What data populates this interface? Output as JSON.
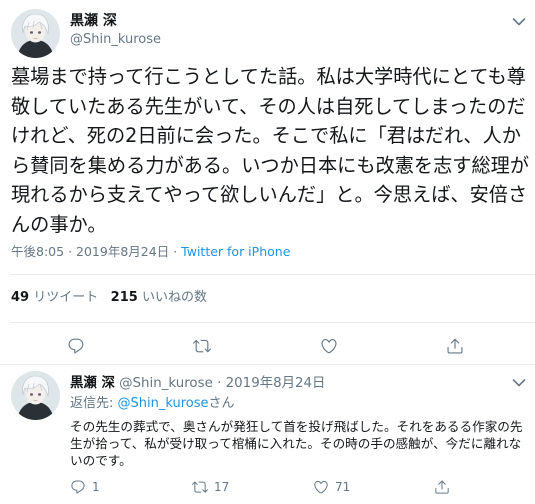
{
  "main_tweet": {
    "display_name": "黒瀬 深",
    "handle": "@Shin_kurose",
    "text": "墓場まで持って行こうとしてた話。私は大学時代にとても尊敬していたある先生がいて、その人は自死してしまったのだけれど、死の2日前に会った。そこで私に「君はだれ、人から賛同を集める力がある。いつか日本にも改憲を志す総理が現れるから支えてやって欲しいんだ」と。今思えば、安倍さんの事か。",
    "time": "午後8:05",
    "date": "2019年8月24日",
    "separator": "·",
    "source": "Twitter for iPhone",
    "retweets_count": "49",
    "retweets_label": "リツイート",
    "likes_count": "215",
    "likes_label": "いいねの数"
  },
  "reply_tweet": {
    "display_name": "黒瀬 深",
    "handle": "@Shin_kurose",
    "separator": "·",
    "date": "2019年8月24日",
    "reply_prefix": "返信先:",
    "reply_mention": "@Shin_kurose",
    "reply_suffix": "さん",
    "text": "その先生の葬式で、奥さんが発狂して首を投げ飛ばした。それをあるる作家の先生が拾って、私が受け取って棺桶に入れた。その時の手の感触が、今だに離れないのです。",
    "reply_count": "1",
    "retweet_count": "17",
    "like_count": "71"
  },
  "icons": {
    "avatar": "avatar-illustration",
    "chevron": "chevron-down-icon",
    "reply": "reply-icon",
    "retweet": "retweet-icon",
    "like": "heart-icon",
    "share": "share-icon"
  },
  "colors": {
    "text": "#14171a",
    "secondary": "#657786",
    "link": "#1b95e0",
    "divider": "#e6ecf0"
  }
}
